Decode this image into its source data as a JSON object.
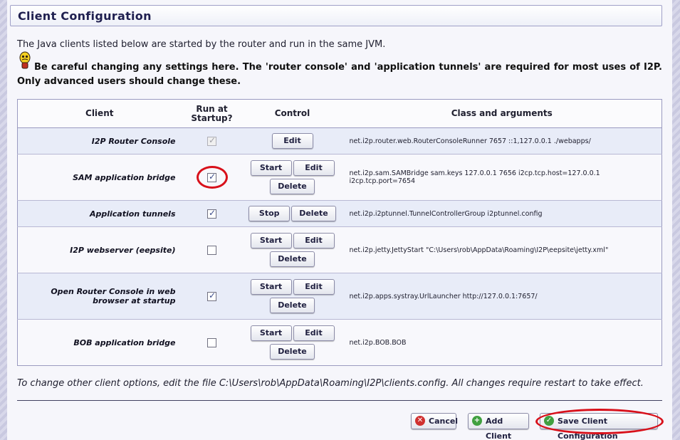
{
  "page": {
    "title": "Client Configuration",
    "intro": "The Java clients listed below are started by the router and run in the same JVM.",
    "warning": "Be careful changing any settings here. The 'router console' and 'application tunnels' are required for most uses of I2P. Only advanced users should change these."
  },
  "table": {
    "headers": {
      "client": "Client",
      "run_at_startup": "Run at Startup?",
      "control": "Control",
      "class_args": "Class and arguments"
    },
    "rows": [
      {
        "name": "I2P Router Console",
        "run_at_startup": true,
        "startup_disabled": true,
        "buttons": [
          "Edit"
        ],
        "args": "net.i2p.router.web.RouterConsoleRunner 7657 ::1,127.0.0.1 ./webapps/"
      },
      {
        "name": "SAM application bridge",
        "run_at_startup": true,
        "startup_disabled": false,
        "buttons": [
          "Start",
          "Edit",
          "Delete"
        ],
        "args": "net.i2p.sam.SAMBridge sam.keys 127.0.0.1 7656 i2cp.tcp.host=127.0.0.1 i2cp.tcp.port=7654"
      },
      {
        "name": "Application tunnels",
        "run_at_startup": true,
        "startup_disabled": false,
        "buttons": [
          "Stop",
          "Delete"
        ],
        "args": "net.i2p.i2ptunnel.TunnelControllerGroup i2ptunnel.config"
      },
      {
        "name": "I2P webserver (eepsite)",
        "run_at_startup": false,
        "startup_disabled": false,
        "buttons": [
          "Start",
          "Edit",
          "Delete"
        ],
        "args": "net.i2p.jetty.JettyStart \"C:\\Users\\rob\\AppData\\Roaming\\I2P\\eepsite\\jetty.xml\""
      },
      {
        "name": "Open Router Console in web browser at startup",
        "run_at_startup": true,
        "startup_disabled": false,
        "buttons": [
          "Start",
          "Edit",
          "Delete"
        ],
        "args": "net.i2p.apps.systray.UrlLauncher http://127.0.0.1:7657/"
      },
      {
        "name": "BOB application bridge",
        "run_at_startup": false,
        "startup_disabled": false,
        "buttons": [
          "Start",
          "Edit",
          "Delete"
        ],
        "args": "net.i2p.BOB.BOB"
      }
    ]
  },
  "footer": {
    "note": "To change other client options, edit the file C:\\Users\\rob\\AppData\\Roaming\\I2P\\clients.config. All changes require restart to take effect.",
    "cancel": "Cancel",
    "add_client": "Add Client",
    "save": "Save Client Configuration"
  },
  "colors": {
    "accent": "#202050",
    "highlight_circle": "#d8101a",
    "row_odd": "#e8ecf8",
    "row_even": "#f8f8fc"
  }
}
